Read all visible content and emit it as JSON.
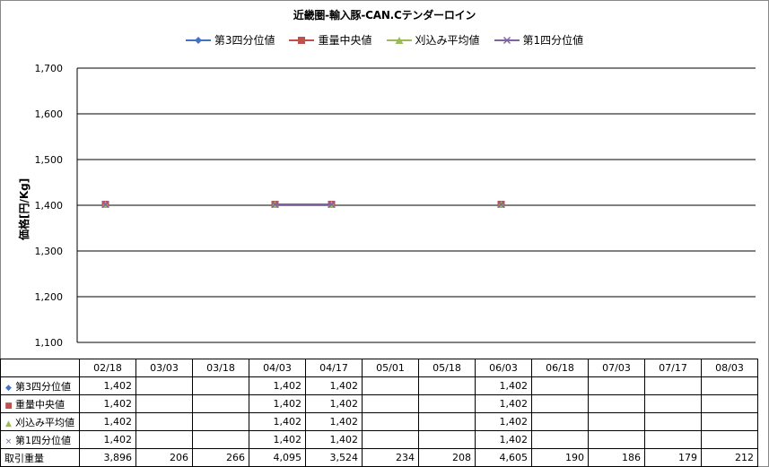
{
  "chart_data": {
    "type": "line",
    "title": "近畿圏-輸入豚-CAN.Cテンダーロイン",
    "ylabel": "価格[円/Kg]",
    "ylim": [
      1100,
      1700
    ],
    "yticks": [
      "1,100",
      "1,200",
      "1,300",
      "1,400",
      "1,500",
      "1,600",
      "1,700"
    ],
    "categories": [
      "02/18",
      "03/03",
      "03/18",
      "04/03",
      "04/17",
      "05/01",
      "05/18",
      "06/03",
      "06/18",
      "07/03",
      "07/17",
      "08/03"
    ],
    "series": [
      {
        "name": "第3四分位値",
        "color": "#4472C4",
        "marker": "diamond",
        "values": [
          1402,
          null,
          null,
          1402,
          1402,
          null,
          null,
          1402,
          null,
          null,
          null,
          null
        ]
      },
      {
        "name": "重量中央値",
        "color": "#C0504D",
        "marker": "square",
        "values": [
          1402,
          null,
          null,
          1402,
          1402,
          null,
          null,
          1402,
          null,
          null,
          null,
          null
        ]
      },
      {
        "name": "刈込み平均値",
        "color": "#9BBB59",
        "marker": "triangle",
        "values": [
          1402,
          null,
          null,
          1402,
          1402,
          null,
          null,
          1402,
          null,
          null,
          null,
          null
        ]
      },
      {
        "name": "第1四分位値",
        "color": "#8064A2",
        "marker": "x",
        "values": [
          1402,
          null,
          null,
          1402,
          1402,
          null,
          null,
          1402,
          null,
          null,
          null,
          null
        ]
      }
    ],
    "legend": "top",
    "grid": true
  },
  "table": {
    "rows": [
      {
        "label": "第3四分位値",
        "marker": "◆",
        "color": "#4472C4",
        "cells": [
          "1,402",
          "",
          "",
          "1,402",
          "1,402",
          "",
          "",
          "1,402",
          "",
          "",
          "",
          ""
        ]
      },
      {
        "label": "重量中央値",
        "marker": "■",
        "color": "#C0504D",
        "cells": [
          "1,402",
          "",
          "",
          "1,402",
          "1,402",
          "",
          "",
          "1,402",
          "",
          "",
          "",
          ""
        ]
      },
      {
        "label": "刈込み平均値",
        "marker": "▲",
        "color": "#9BBB59",
        "cells": [
          "1,402",
          "",
          "",
          "1,402",
          "1,402",
          "",
          "",
          "1,402",
          "",
          "",
          "",
          ""
        ]
      },
      {
        "label": "第1四分位値",
        "marker": "×",
        "color": "#8064A2",
        "cells": [
          "1,402",
          "",
          "",
          "1,402",
          "1,402",
          "",
          "",
          "1,402",
          "",
          "",
          "",
          ""
        ]
      },
      {
        "label": "取引重量",
        "marker": "",
        "color": "#000000",
        "cells": [
          "3,896",
          "206",
          "266",
          "4,095",
          "3,524",
          "234",
          "208",
          "4,605",
          "190",
          "186",
          "179",
          "212"
        ]
      }
    ]
  }
}
